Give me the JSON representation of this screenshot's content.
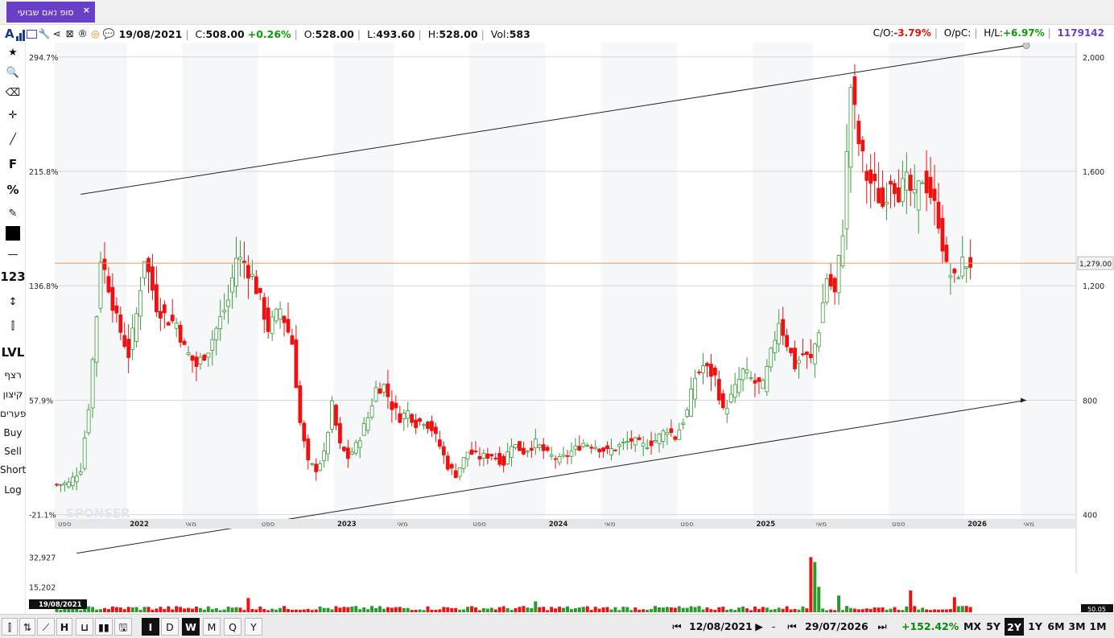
{
  "tab": {
    "label": "סופ נאם שבועי",
    "close": "×"
  },
  "header": {
    "logo": "A",
    "date": "19/08/2021",
    "close_label": "C:",
    "close_value": "508.00",
    "change": "+0.26%",
    "open_label": "O:",
    "open_value": "528.00",
    "low_label": "L:",
    "low_value": "493.60",
    "high_label": "H:",
    "high_value": "528.00",
    "vol_label": "Vol:",
    "vol_value": "583",
    "co_label": "C/O:",
    "co_value": "-3.79%",
    "opc_label": "O/pC:",
    "hl_label": "H/L:",
    "hl_value": "+6.97%",
    "id": "1179142",
    "colors": {
      "up": "#0a9a0a",
      "down": "#e01010",
      "accent": "#6a3fc7"
    }
  },
  "toolbar": [
    {
      "name": "star-icon",
      "glyph": "★"
    },
    {
      "name": "search-icon",
      "glyph": "🔍"
    },
    {
      "name": "eraser-icon",
      "glyph": "⌫"
    },
    {
      "name": "crosshair-icon",
      "glyph": "✛"
    },
    {
      "name": "line-tool-icon",
      "glyph": "╱"
    },
    {
      "name": "fibonacci-tool",
      "glyph": "F"
    },
    {
      "name": "percent-tool",
      "glyph": "%"
    },
    {
      "name": "edit-icon",
      "glyph": "✎"
    },
    {
      "name": "color-swatch",
      "glyph": ""
    },
    {
      "name": "horizontal-line-tool",
      "glyph": "—"
    },
    {
      "name": "number-tool",
      "glyph": "123"
    },
    {
      "name": "vertical-measure-tool",
      "glyph": "↕"
    },
    {
      "name": "candle-type-icon",
      "glyph": "⫿"
    },
    {
      "name": "level-tool",
      "glyph": "LVL"
    },
    {
      "name": "continuous-tool",
      "glyph": "רצף"
    },
    {
      "name": "adjust-tool",
      "glyph": "קיצון"
    },
    {
      "name": "gaps-tool",
      "glyph": "פערים"
    },
    {
      "name": "buy-button",
      "glyph": "Buy"
    },
    {
      "name": "sell-button",
      "glyph": "Sell"
    },
    {
      "name": "short-button",
      "glyph": "Short"
    },
    {
      "name": "log-button",
      "glyph": "Log"
    }
  ],
  "chart_data": {
    "type": "candlestick",
    "left_axis_labels": [
      "294.7%",
      "215.8%",
      "136.8%",
      "57.9%",
      "-21.1%"
    ],
    "right_axis_labels": [
      "2,000",
      "1,600",
      "1,200",
      "800",
      "400"
    ],
    "right_axis_values": [
      2000,
      1600,
      1200,
      800,
      400
    ],
    "ylim": [
      385,
      2050
    ],
    "current_price": 1279,
    "current_price_label": "1,279.00",
    "x_labels": [
      "ספט",
      "2022",
      "מאי",
      "ספט",
      "2023",
      "מאי",
      "ספט",
      "2024",
      "מאי",
      "ספט",
      "2025",
      "מאי",
      "ספט",
      "2026",
      "מאי"
    ],
    "x_label_positions": [
      0,
      18,
      32,
      51,
      70,
      85,
      104,
      123,
      137,
      156,
      175,
      190,
      209,
      228,
      242
    ],
    "n_bars": 256,
    "volume_axis_labels": [
      "32,927",
      "15,202"
    ],
    "volume_max": 50000,
    "volume_date_label": "19/08/2021",
    "volume_corner_label": "50.05",
    "close_path": [
      [
        0,
        505
      ],
      [
        3,
        510
      ],
      [
        6,
        560
      ],
      [
        8,
        780
      ],
      [
        10,
        1100
      ],
      [
        11,
        1300
      ],
      [
        13,
        1200
      ],
      [
        15,
        1080
      ],
      [
        18,
        960
      ],
      [
        20,
        1100
      ],
      [
        22,
        1300
      ],
      [
        25,
        1130
      ],
      [
        28,
        1080
      ],
      [
        30,
        1070
      ],
      [
        32,
        980
      ],
      [
        35,
        920
      ],
      [
        38,
        980
      ],
      [
        40,
        1050
      ],
      [
        43,
        1150
      ],
      [
        45,
        1300
      ],
      [
        47,
        1280
      ],
      [
        49,
        1230
      ],
      [
        51,
        1150
      ],
      [
        53,
        1050
      ],
      [
        56,
        1120
      ],
      [
        59,
        1000
      ],
      [
        61,
        720
      ],
      [
        63,
        580
      ],
      [
        65,
        560
      ],
      [
        67,
        610
      ],
      [
        69,
        780
      ],
      [
        71,
        640
      ],
      [
        73,
        600
      ],
      [
        75,
        640
      ],
      [
        78,
        740
      ],
      [
        80,
        840
      ],
      [
        82,
        850
      ],
      [
        84,
        780
      ],
      [
        86,
        740
      ],
      [
        88,
        760
      ],
      [
        90,
        720
      ],
      [
        92,
        730
      ],
      [
        94,
        700
      ],
      [
        96,
        640
      ],
      [
        98,
        570
      ],
      [
        100,
        540
      ],
      [
        103,
        620
      ],
      [
        106,
        600
      ],
      [
        109,
        610
      ],
      [
        112,
        580
      ],
      [
        114,
        650
      ],
      [
        117,
        620
      ],
      [
        120,
        650
      ],
      [
        123,
        610
      ],
      [
        126,
        590
      ],
      [
        129,
        620
      ],
      [
        132,
        650
      ],
      [
        135,
        640
      ],
      [
        138,
        620
      ],
      [
        141,
        640
      ],
      [
        144,
        660
      ],
      [
        147,
        640
      ],
      [
        150,
        660
      ],
      [
        153,
        700
      ],
      [
        155,
        670
      ],
      [
        158,
        760
      ],
      [
        160,
        880
      ],
      [
        162,
        920
      ],
      [
        165,
        880
      ],
      [
        167,
        760
      ],
      [
        169,
        810
      ],
      [
        172,
        900
      ],
      [
        175,
        860
      ],
      [
        177,
        850
      ],
      [
        179,
        960
      ],
      [
        181,
        1080
      ],
      [
        183,
        1000
      ],
      [
        185,
        920
      ],
      [
        187,
        960
      ],
      [
        189,
        940
      ],
      [
        191,
        1050
      ],
      [
        193,
        1230
      ],
      [
        195,
        1170
      ],
      [
        197,
        1400
      ],
      [
        199,
        1900
      ],
      [
        201,
        1700
      ],
      [
        203,
        1580
      ],
      [
        205,
        1540
      ],
      [
        207,
        1480
      ],
      [
        209,
        1580
      ],
      [
        211,
        1530
      ],
      [
        213,
        1560
      ],
      [
        215,
        1500
      ],
      [
        217,
        1580
      ],
      [
        219,
        1520
      ],
      [
        221,
        1430
      ],
      [
        223,
        1260
      ],
      [
        225,
        1220
      ],
      [
        227,
        1280
      ],
      [
        229,
        1279
      ]
    ],
    "volume_spikes": [
      {
        "bar": 189,
        "value": 32927
      },
      {
        "bar": 190,
        "value": 30000
      },
      {
        "bar": 191,
        "value": 15202
      },
      {
        "bar": 120,
        "value": 6500
      },
      {
        "bar": 48,
        "value": 8500
      },
      {
        "bar": 214,
        "value": 13000
      },
      {
        "bar": 225,
        "value": 9000
      },
      {
        "bar": 196,
        "value": 10000
      }
    ],
    "trendlines": [
      {
        "from": [
          6,
          1520
        ],
        "to": [
          243,
          2040
        ]
      },
      {
        "from": [
          5,
          265
        ],
        "to": [
          243,
          800
        ]
      }
    ],
    "up_color": "#3a9a3a",
    "down_color": "#f01010",
    "price_line_color": "#e89a50"
  },
  "sponsor_watermark": "SPONSER",
  "bottom": {
    "buttons_left": [
      "I",
      "D",
      "W",
      "M",
      "Q",
      "Y"
    ],
    "active_period": "W",
    "date_from": "12/08/2021",
    "dash": "-",
    "date_to": "29/07/2026",
    "change": "+152.42%",
    "ranges": [
      "MX",
      "5Y",
      "2Y",
      "1Y",
      "6M",
      "3M",
      "1M"
    ],
    "active_range": "2Y",
    "rewind": "⏮",
    "back": "◀",
    "fwd": "▶",
    "fast_fwd": "⏭"
  }
}
